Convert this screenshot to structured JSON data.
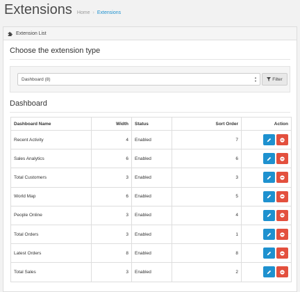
{
  "header": {
    "title": "Extensions",
    "breadcrumb": [
      "Home",
      "Extensions"
    ],
    "breadcrumb_separator": "›"
  },
  "panel": {
    "heading_icon": "puzzle-icon",
    "heading": "Extension List"
  },
  "chooser": {
    "title": "Choose the extension type",
    "selected": "Dashboard (8)",
    "filter_label": "Filter"
  },
  "table": {
    "title": "Dashboard",
    "columns": [
      "Dashboard Name",
      "Width",
      "Status",
      "Sort Order",
      "Action"
    ],
    "rows": [
      {
        "name": "Recent Activity",
        "width": "4",
        "status": "Enabled",
        "sort": "7"
      },
      {
        "name": "Sales Analytics",
        "width": "6",
        "status": "Enabled",
        "sort": "6"
      },
      {
        "name": "Total Customers",
        "width": "3",
        "status": "Enabled",
        "sort": "3"
      },
      {
        "name": "World Map",
        "width": "6",
        "status": "Enabled",
        "sort": "5"
      },
      {
        "name": "People Online",
        "width": "3",
        "status": "Enabled",
        "sort": "4"
      },
      {
        "name": "Total Orders",
        "width": "3",
        "status": "Enabled",
        "sort": "1"
      },
      {
        "name": "Latest Orders",
        "width": "8",
        "status": "Enabled",
        "sort": "8"
      },
      {
        "name": "Total Sales",
        "width": "3",
        "status": "Enabled",
        "sort": "2"
      }
    ]
  },
  "colors": {
    "edit_button": "#1e91cf",
    "delete_button": "#e3503e",
    "link": "#1e91cf"
  }
}
